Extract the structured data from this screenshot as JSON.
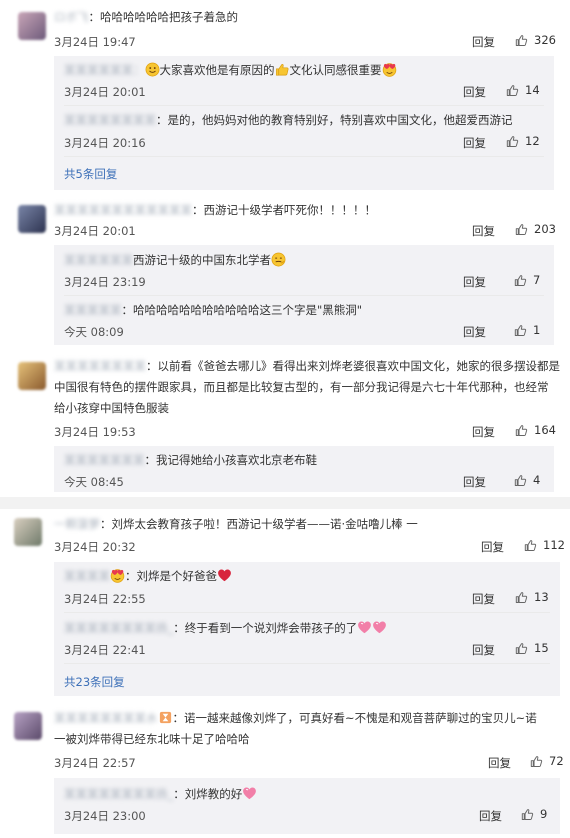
{
  "labels": {
    "reply": "回复"
  },
  "panel1": {
    "c1": {
      "user": "ロボ飞",
      "text": "：哈哈哈哈哈哈把孩子着急的",
      "time": "3月24日 19:47",
      "likes": "326",
      "replies": [
        {
          "user": "某某某某某某：",
          "text1": "大家喜欢他是有原因的",
          "text2": "文化认同感很重要",
          "time": "3月24日 20:01",
          "likes": "14"
        },
        {
          "user": "某某某某某某某某",
          "text": "：是的，他妈妈对他的教育特别好，特别喜欢中国文化，他超爱西游记",
          "time": "3月24日 20:16",
          "likes": "12"
        }
      ],
      "more": "共5条回复"
    },
    "c2": {
      "user": "某某某某某某某某某某某某",
      "text": "：西游记十级学者吓死你！！！！！",
      "time": "3月24日 20:01",
      "likes": "203",
      "replies": [
        {
          "user": "某某某某某某",
          "text": "西游记十级的中国东北学者",
          "time": "3月24日 23:19",
          "likes": "7"
        },
        {
          "user": "某某某某某",
          "text": "：哈哈哈哈哈哈哈哈哈哈哈这三个字是\"黑熊洞\"",
          "time": "今天 08:09",
          "likes": "1"
        }
      ]
    },
    "c3": {
      "user": "某某某某某某某某",
      "line1": "：以前看《爸爸去哪儿》看得出来刘烨老婆很喜欢中国文化，她家的很多摆设都是",
      "line2": "中国很有特色的摆件跟家具，而且都是比较复古型的，有一部分我记得是六七十年代那种，也经常",
      "line3": "给小孩穿中国特色服装",
      "time": "3月24日 19:53",
      "likes": "164",
      "replies": [
        {
          "user": "某某某某某某某",
          "text": "：我记得她给小孩喜欢北京老布鞋",
          "time": "今天 08:45",
          "likes": "4"
        }
      ]
    }
  },
  "panel2": {
    "c4": {
      "user": "一颗菠萝",
      "text": "：刘烨太会教育孩子啦！西游记十级学者——诺·金咕噜儿棒 一",
      "time": "3月24日 20:32",
      "likes": "112",
      "replies": [
        {
          "user": "某某某某",
          "text": "：刘烨是个好爸爸",
          "time": "3月24日 22:55",
          "likes": "13"
        },
        {
          "user": "某某某某某某某某扬_",
          "text": "：终于看到一个说刘烨会带孩子的了",
          "time": "3月24日 22:41",
          "likes": "15"
        }
      ],
      "more": "共23条回复"
    },
    "c5": {
      "user": "某某某某某某某某水",
      "line1": "：诺一越来越像刘烨了，可真好看~不愧是和观音菩萨聊过的宝贝儿~诺",
      "line2": "一被刘烨带得已经东北味十足了哈哈哈",
      "time": "3月24日 22:57",
      "likes": "72",
      "replies": [
        {
          "user": "某某某某某某某某扬_",
          "text": "：刘烨教的好",
          "time": "3月24日 23:00",
          "likes": "9"
        }
      ]
    }
  }
}
